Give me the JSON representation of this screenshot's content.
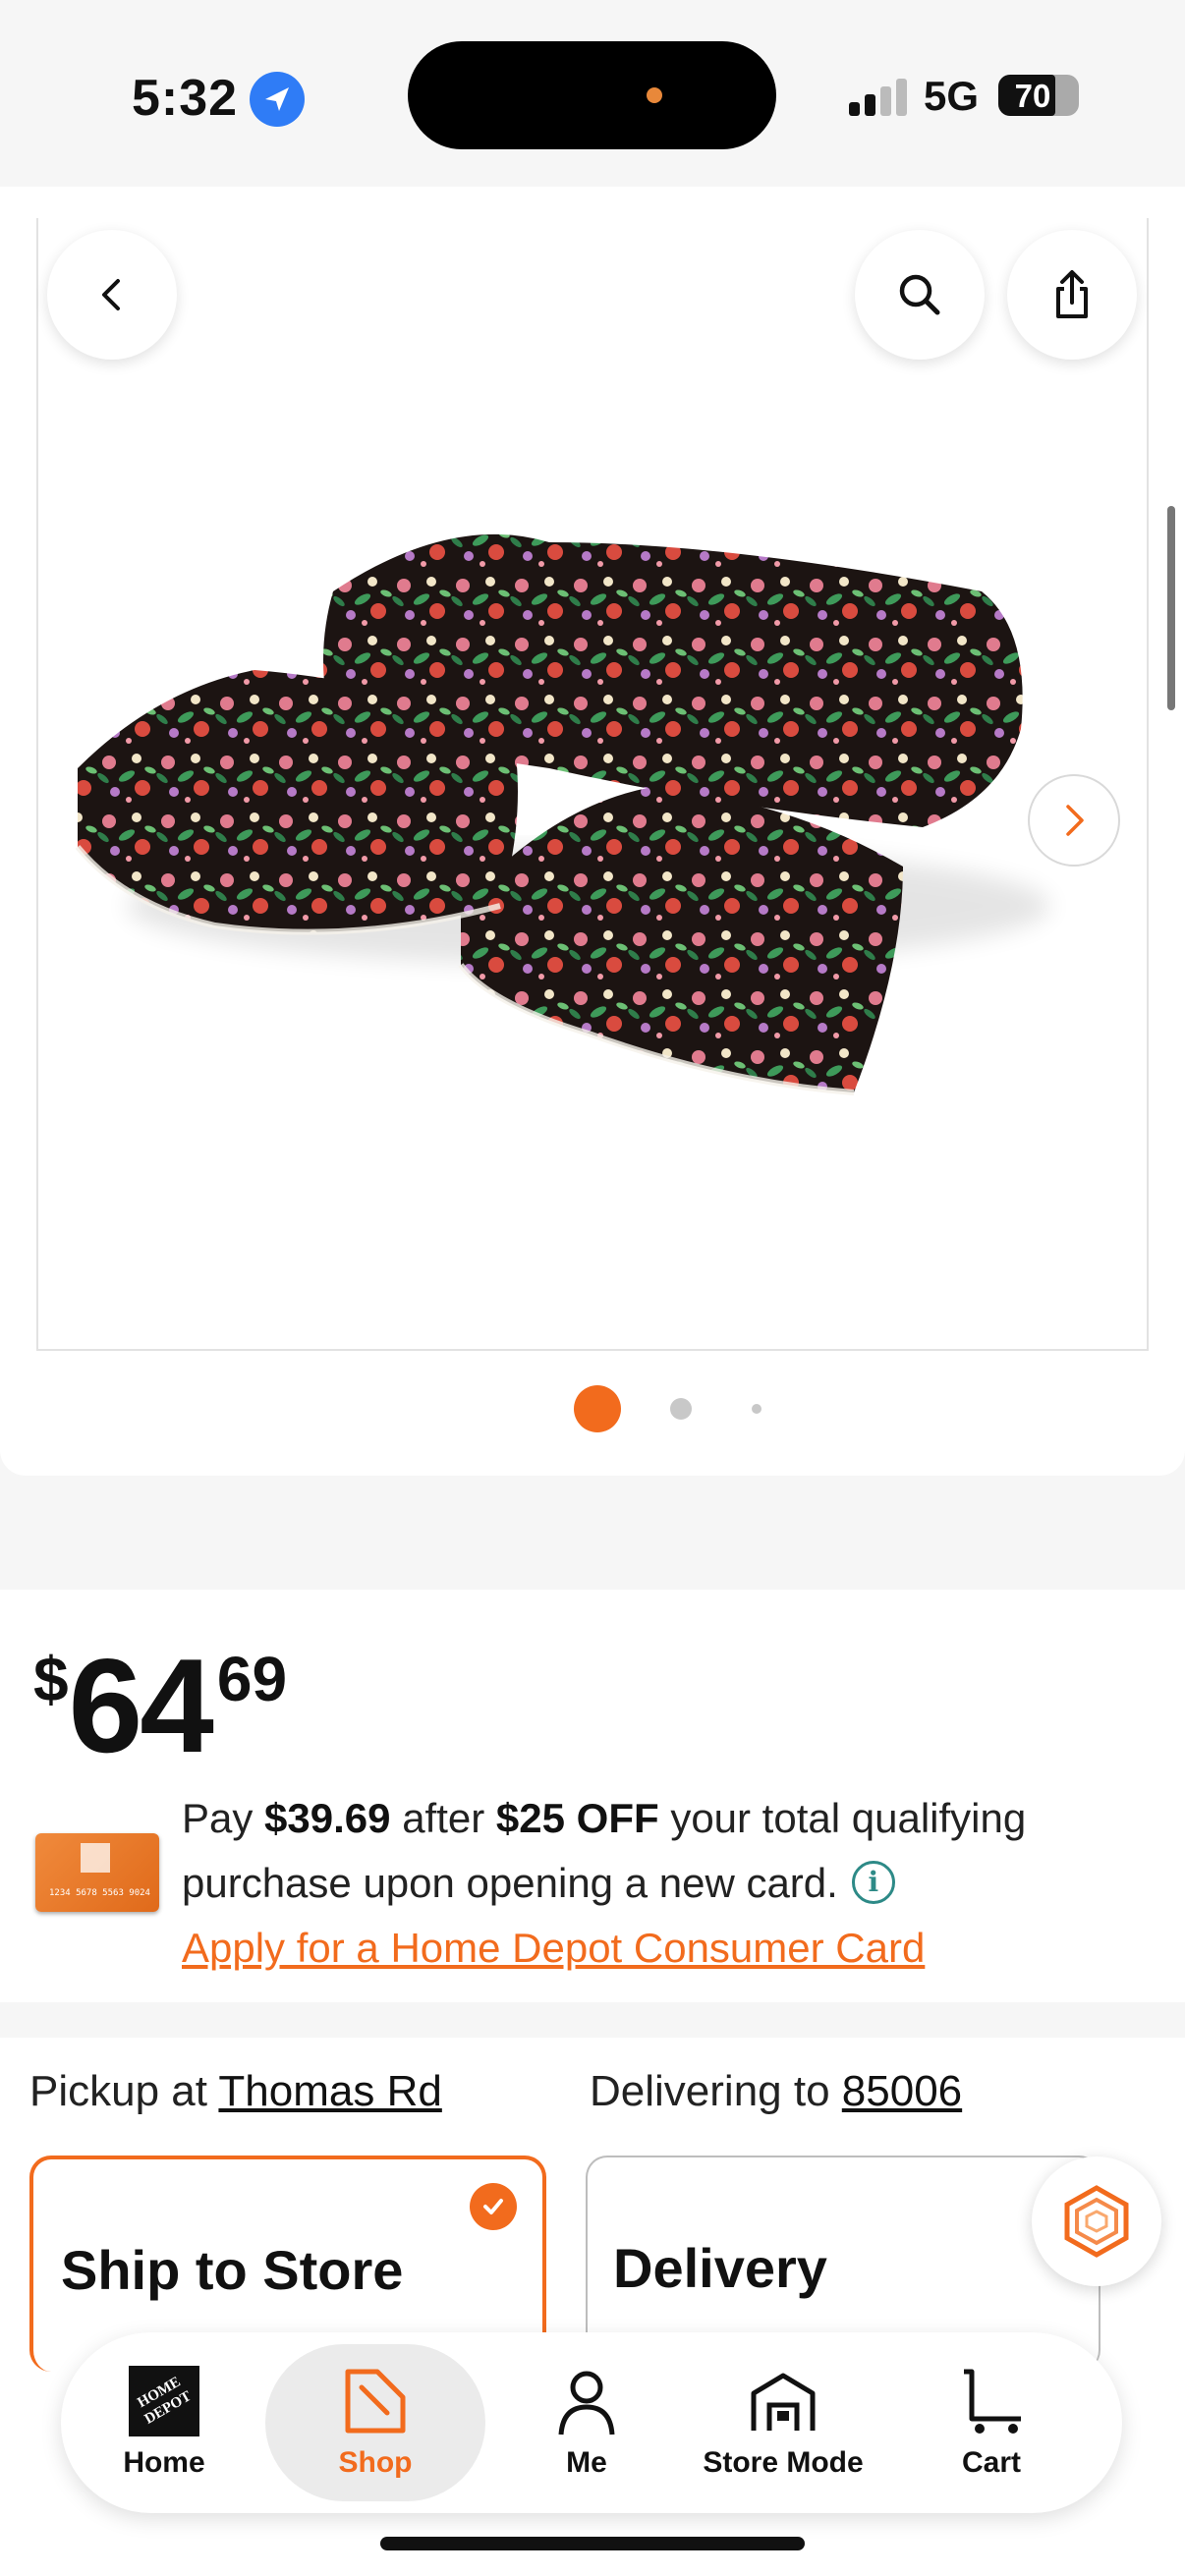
{
  "status_bar": {
    "time": "5:32",
    "network": "5G",
    "battery": "70"
  },
  "gallery": {
    "dot_count": 3,
    "active_dot": 0
  },
  "price": {
    "currency": "$",
    "dollars": "64",
    "cents": "69"
  },
  "promo": {
    "pay_prefix": "Pay",
    "pay_amount": "$39.69",
    "after": "after",
    "discount": "$25 OFF",
    "text_rest": "your total qualifying purchase upon opening a new card.",
    "info": "i",
    "apply_link": "Apply for a Home Depot Consumer Card",
    "card_number": "1234 5678 5563 9024"
  },
  "fulfillment": {
    "pickup_prefix": "Pickup at",
    "pickup_store": "Thomas Rd",
    "delivery_prefix": "Delivering to",
    "delivery_zip": "85006",
    "options": [
      {
        "title": "Ship to Store",
        "selected": true
      },
      {
        "title": "Delivery",
        "selected": false
      }
    ]
  },
  "tabs": [
    {
      "label": "Home",
      "icon": "home-depot-logo-icon"
    },
    {
      "label": "Shop",
      "icon": "shop-icon",
      "active": true
    },
    {
      "label": "Me",
      "icon": "person-icon"
    },
    {
      "label": "Store Mode",
      "icon": "store-icon"
    },
    {
      "label": "Cart",
      "icon": "cart-icon"
    }
  ],
  "colors": {
    "accent": "#f26b1d",
    "info_teal": "#2d8a87",
    "text": "#111111"
  }
}
